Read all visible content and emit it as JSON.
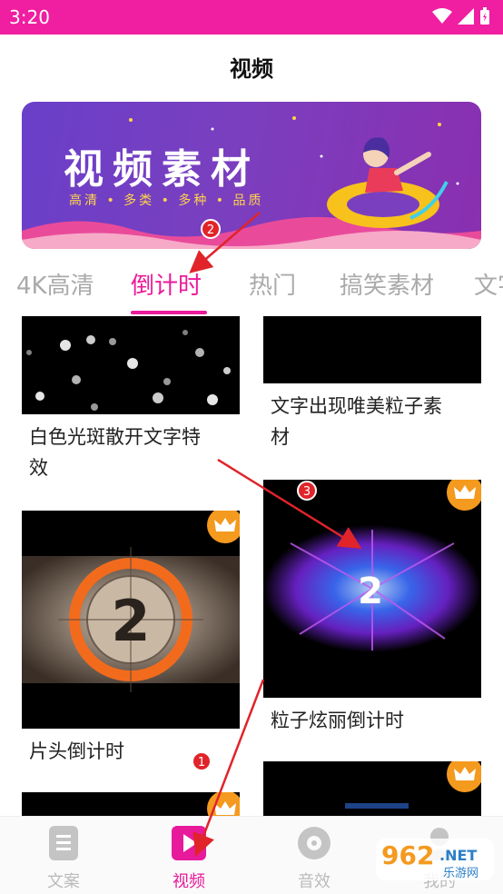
{
  "status": {
    "time": "3:20"
  },
  "page": {
    "title": "视频"
  },
  "banner": {
    "title": "视频素材",
    "subtitle": "高清 • 多类 • 多种 • 品质"
  },
  "tabs": [
    {
      "label": "4K高清",
      "active": false
    },
    {
      "label": "倒计时",
      "active": true
    },
    {
      "label": "热门",
      "active": false
    },
    {
      "label": "搞笑素材",
      "active": false
    },
    {
      "label": "文字",
      "active": false
    }
  ],
  "videos": [
    {
      "title_line1": "白色光斑散开文字特",
      "title_line2": "效",
      "vip": false
    },
    {
      "title_line1": "文字出现唯美粒子素",
      "title_line2": "材",
      "vip": false
    },
    {
      "title_line1": "片头倒计时",
      "vip": true,
      "number": "2"
    },
    {
      "title_line1": "粒子炫丽倒计时",
      "vip": true,
      "number": "2"
    }
  ],
  "nav": [
    {
      "label": "文案",
      "icon": "document-icon",
      "active": false
    },
    {
      "label": "视频",
      "icon": "video-play-icon",
      "active": true
    },
    {
      "label": "音效",
      "icon": "music-disc-icon",
      "active": false
    },
    {
      "label": "我的",
      "icon": "profile-icon",
      "active": false
    }
  ],
  "annotations": [
    "1",
    "2",
    "3"
  ],
  "watermark": {
    "brand": "962",
    "domain": ".NET",
    "sub": "乐游网"
  },
  "colors": {
    "accent": "#ea1a9a",
    "status": "#f01ea0",
    "crown": "#f49a1f"
  }
}
